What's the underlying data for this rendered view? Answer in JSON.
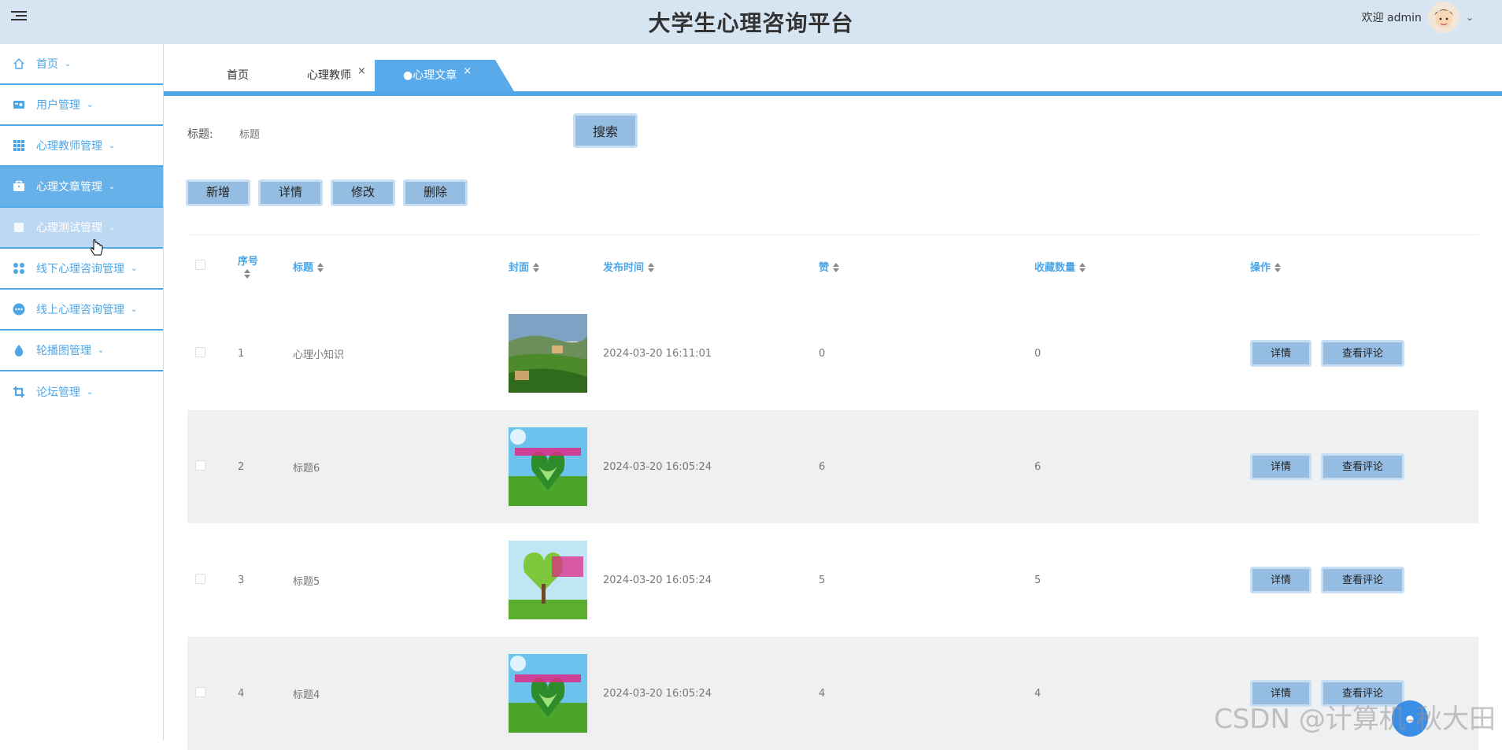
{
  "header": {
    "title": "大学生心理咨询平台",
    "welcome": "欢迎 admin"
  },
  "sidebar": {
    "items": [
      {
        "label": "首页",
        "icon": "home-icon"
      },
      {
        "label": "用户管理",
        "icon": "user-card-icon"
      },
      {
        "label": "心理教师管理",
        "icon": "grid-icon"
      },
      {
        "label": "心理文章管理",
        "icon": "briefcase-icon"
      },
      {
        "label": "心理测试管理",
        "icon": "book-icon"
      },
      {
        "label": "线下心理咨询管理",
        "icon": "apps-icon"
      },
      {
        "label": "线上心理咨询管理",
        "icon": "more-icon"
      },
      {
        "label": "轮播图管理",
        "icon": "drop-icon"
      },
      {
        "label": "论坛管理",
        "icon": "crop-icon"
      }
    ]
  },
  "tabs": [
    {
      "label": "首页"
    },
    {
      "label": "心理教师",
      "close": "×"
    },
    {
      "label": "●心理文章",
      "close": "×"
    }
  ],
  "search": {
    "label": "标题:",
    "placeholder": "标题",
    "button": "搜索"
  },
  "actions": {
    "add": "新增",
    "detail": "详情",
    "edit": "修改",
    "delete": "删除"
  },
  "table": {
    "columns": [
      "序号",
      "标题",
      "封面",
      "发布时间",
      "赞",
      "收藏数量",
      "操作"
    ],
    "rows": [
      {
        "index": "1",
        "title": "心理小知识",
        "time": "2024-03-20 16:11:01",
        "likes": "0",
        "favorites": "0",
        "cover": "landscape"
      },
      {
        "index": "2",
        "title": "标题6",
        "time": "2024-03-20 16:05:24",
        "likes": "6",
        "favorites": "6",
        "cover": "poster-a"
      },
      {
        "index": "3",
        "title": "标题5",
        "time": "2024-03-20 16:05:24",
        "likes": "5",
        "favorites": "5",
        "cover": "poster-b"
      },
      {
        "index": "4",
        "title": "标题4",
        "time": "2024-03-20 16:05:24",
        "likes": "4",
        "favorites": "4",
        "cover": "poster-a"
      }
    ],
    "row_detail": "详情",
    "row_comments": "查看评论"
  },
  "watermark": "CSDN @计算机-秋大田",
  "colors": {
    "accent": "#4fa6e6",
    "header_bg": "#d7e5f3",
    "button": "#95bde2"
  }
}
